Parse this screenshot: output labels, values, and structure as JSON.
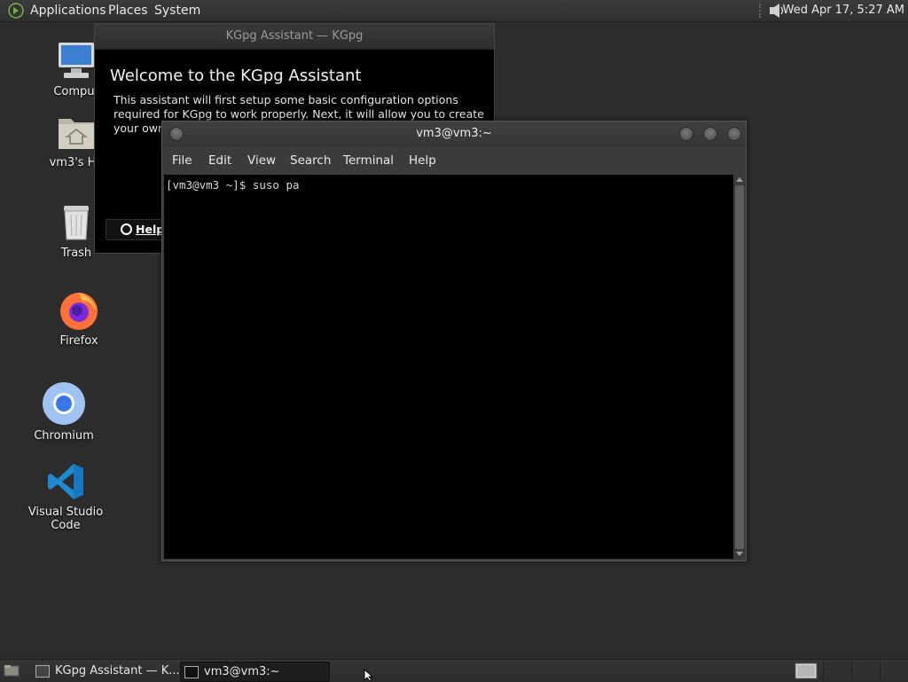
{
  "top_panel": {
    "menus": [
      "Applications",
      "Places",
      "System"
    ],
    "clock": "Wed Apr 17,  5:27 AM"
  },
  "desktop_icons": [
    {
      "label": "Comput",
      "icon": "computer-icon"
    },
    {
      "label": "vm3's Ho",
      "icon": "home-folder-icon"
    },
    {
      "label": "Trash",
      "icon": "trash-icon"
    },
    {
      "label": "Firefox",
      "icon": "firefox-icon"
    },
    {
      "label": "Chromium",
      "icon": "chromium-icon"
    },
    {
      "label": "Visual Studio Code",
      "icon": "vscode-icon"
    }
  ],
  "kgpg_window": {
    "title": "KGpg Assistant — KGpg",
    "heading": "Welcome to the KGpg Assistant",
    "description": "This assistant will first setup some basic configuration options required for KGpg to work properly. Next, it will allow you to create your own key pair, enab",
    "help_label": "Help"
  },
  "terminal_window": {
    "title": "vm3@vm3:~",
    "menus": [
      "File",
      "Edit",
      "View",
      "Search",
      "Terminal",
      "Help"
    ],
    "line": "[vm3@vm3 ~]$ suso pa"
  },
  "taskbar": {
    "tasks": [
      "KGpg Assistant — K...",
      "vm3@vm3:~"
    ]
  },
  "colors": {
    "desktop_bg": "#2b2c2b",
    "terminal_bg": "#000000",
    "panel_bg": "#303130"
  }
}
